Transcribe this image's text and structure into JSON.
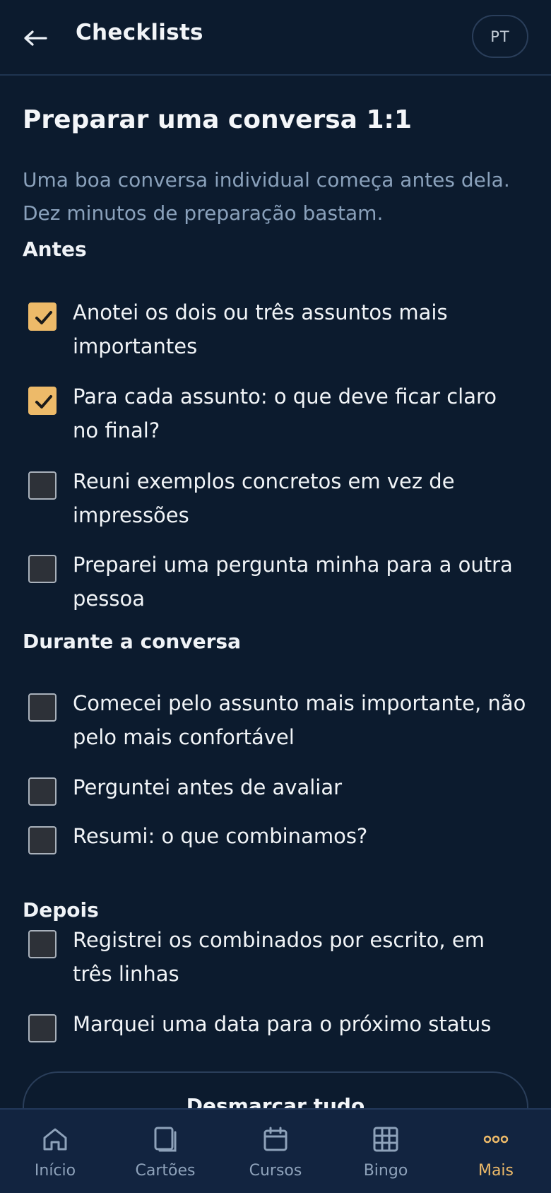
{
  "header": {
    "title": "Checklists",
    "language": "PT"
  },
  "page": {
    "title": "Preparar uma conversa 1:1",
    "intro": "Uma boa conversa individual começa antes dela. Dez minutos de preparação bastam."
  },
  "sections": [
    {
      "heading": "Antes",
      "items": [
        {
          "label": "Anotei os dois ou três assuntos mais importantes",
          "checked": true
        },
        {
          "label": "Para cada assunto: o que deve ficar claro no final?",
          "checked": true
        },
        {
          "label": "Reuni exemplos concretos em vez de impressões",
          "checked": false
        },
        {
          "label": "Preparei uma pergunta minha para a outra pessoa",
          "checked": false
        }
      ]
    },
    {
      "heading": "Durante a conversa",
      "items": [
        {
          "label": "Comecei pelo assunto mais importante, não pelo mais confortável",
          "checked": false
        },
        {
          "label": "Perguntei antes de avaliar",
          "checked": false
        },
        {
          "label": "Resumi: o que combinamos?",
          "checked": false
        }
      ]
    },
    {
      "heading": "Depois",
      "items": [
        {
          "label": "Registrei os combinados por escrito, em três linhas",
          "checked": false
        },
        {
          "label": "Marquei uma data para o próximo status",
          "checked": false
        }
      ]
    }
  ],
  "actions": {
    "reset_label": "Desmarcar tudo"
  },
  "tabbar": {
    "tabs": [
      {
        "label": "Início",
        "icon": "home-icon",
        "active": false
      },
      {
        "label": "Cartões",
        "icon": "cards-icon",
        "active": false
      },
      {
        "label": "Cursos",
        "icon": "calendar-icon",
        "active": false
      },
      {
        "label": "Bingo",
        "icon": "grid-icon",
        "active": false
      },
      {
        "label": "Mais",
        "icon": "more-icon",
        "active": true
      }
    ]
  },
  "colors": {
    "background": "#0c1b2e",
    "accent": "#edba69",
    "muted_text": "#8aa1bb",
    "tabbar_background": "#122440"
  }
}
